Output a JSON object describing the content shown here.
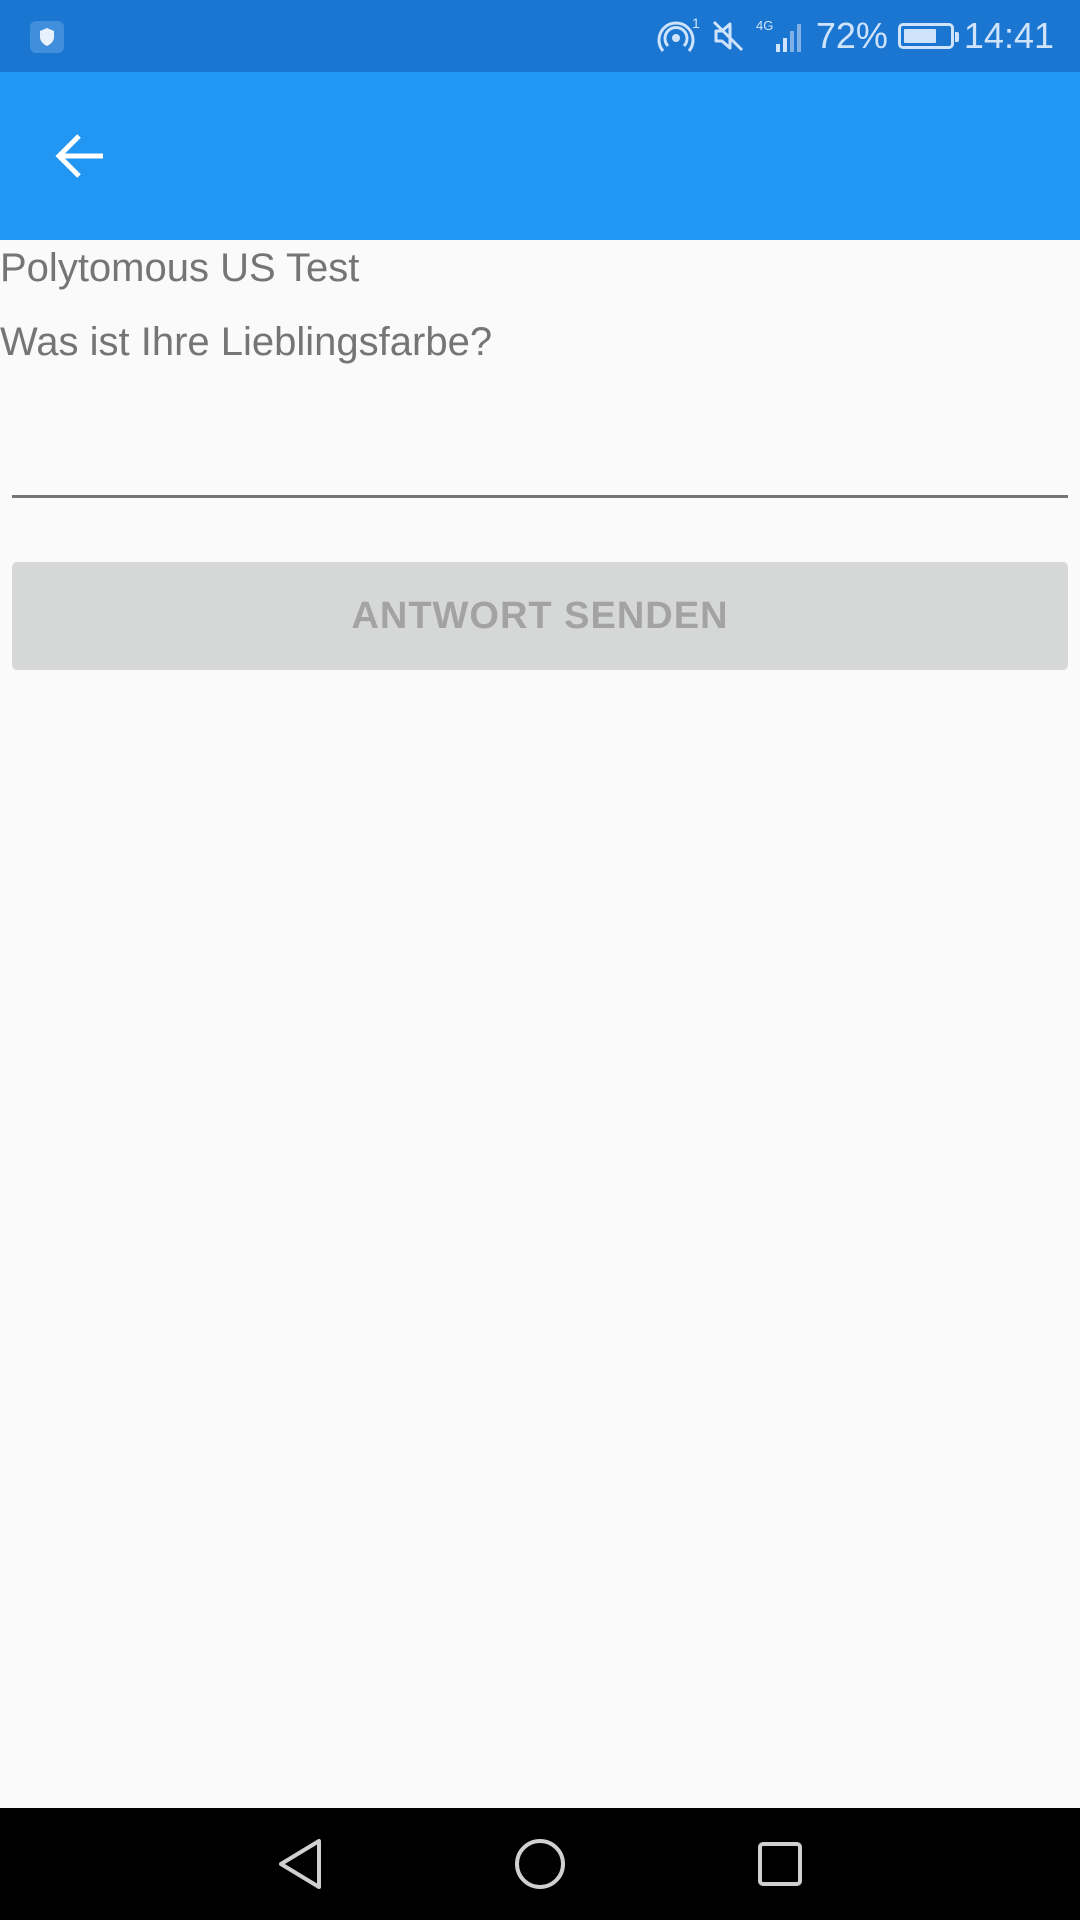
{
  "status_bar": {
    "battery_percent": "72%",
    "battery_level": 0.72,
    "time": "14:41",
    "network_label": "4G",
    "hotspot_sup": "1",
    "icons": [
      "shield-app-icon",
      "hotspot-icon",
      "mute-icon",
      "signal-4g-icon",
      "battery-icon"
    ]
  },
  "app_bar": {
    "back_icon": "arrow-left-icon",
    "color": "#2196f3"
  },
  "content": {
    "survey_title": "Polytomous US Test",
    "question": "Was ist Ihre Lieblingsfarbe?",
    "answer_value": "",
    "answer_placeholder": "",
    "submit_label": "ANTWORT SENDEN"
  },
  "nav_bar": {
    "icons": [
      "back-triangle-icon",
      "home-circle-icon",
      "recents-square-icon"
    ]
  },
  "colors": {
    "status_bar": "#1b76d1",
    "app_bar": "#2196f3",
    "background": "#fafafa",
    "button_disabled": "#d6d7d7",
    "button_text_disabled": "#a3a3a3",
    "text_secondary": "#757575"
  }
}
